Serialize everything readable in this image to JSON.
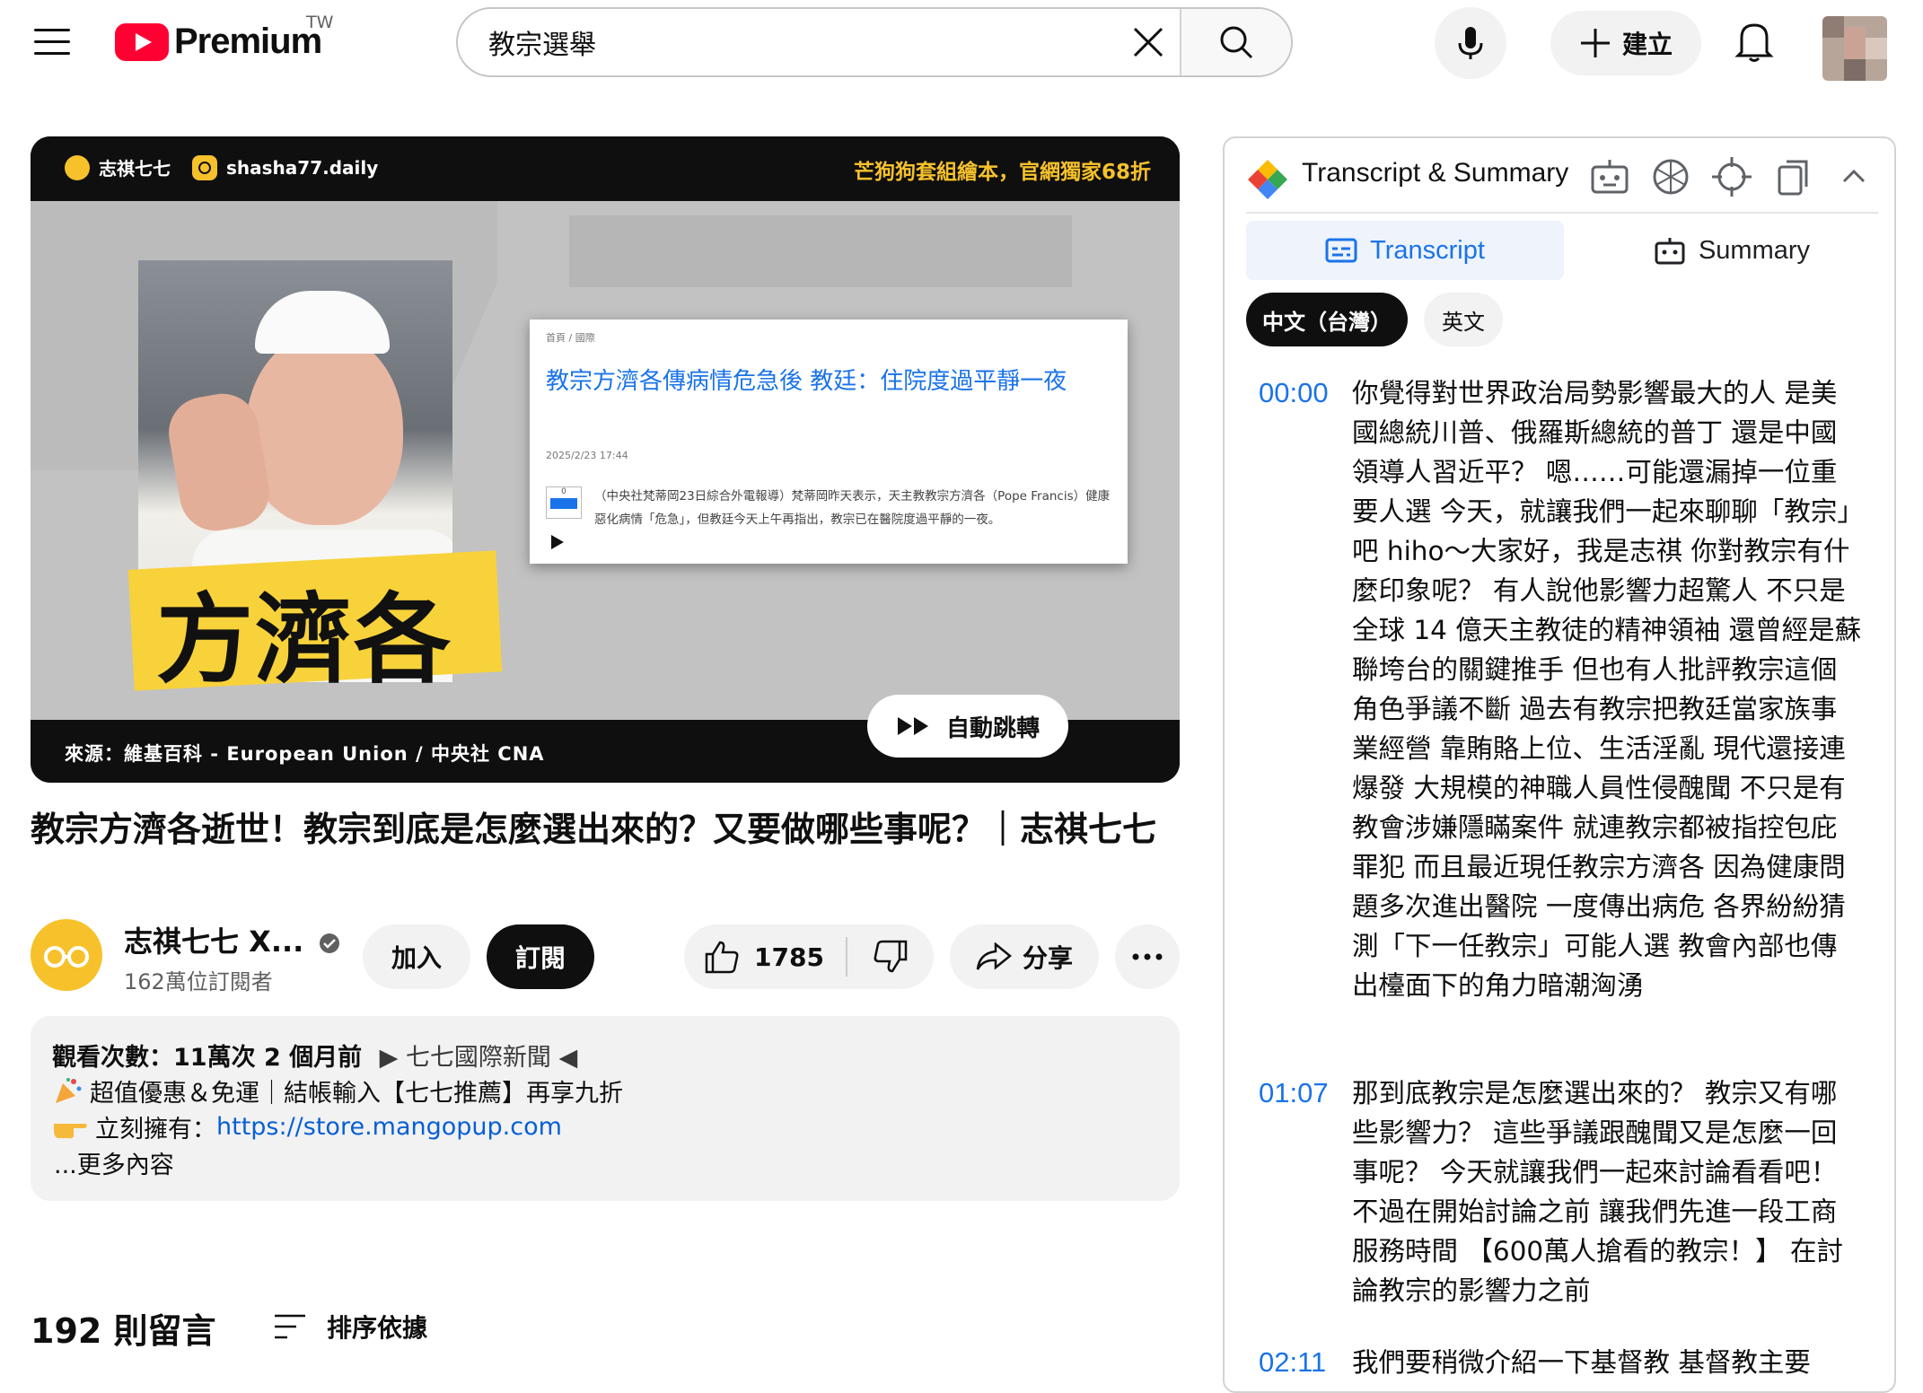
{
  "header": {
    "logo_text": "Premium",
    "region": "TW",
    "search_value": "教宗選舉",
    "create_label": "建立"
  },
  "video": {
    "top_left_handle_1": "志祺七七",
    "top_left_handle_2": "shasha77.daily",
    "top_right_promo": "芒狗狗套組繪本，官網獨家68折",
    "name_overlay": "方濟各",
    "article_breadcrumb": "首頁 / 國際",
    "article_title": "教宗方濟各傳病情危急後 教廷：住院度過平靜一夜",
    "article_date": "2025/2/23 17:44",
    "article_like_count": "0",
    "article_body": "（中央社梵蒂岡23日綜合外電報導）梵蒂岡昨天表示，天主教教宗方濟各（Pope Francis）健康惡化病情「危急」，但教廷今天上午再指出，教宗已在醫院度過平靜的一夜。",
    "source_caption": "來源：維基百科 - European Union / 中央社 CNA",
    "autoskip_label": "自動跳轉",
    "title": "教宗方濟各逝世！教宗到底是怎麼選出來的？又要做哪些事呢？｜志祺七七"
  },
  "channel": {
    "name": "志祺七七 X...",
    "subscribers": "162萬位訂閱者",
    "join_label": "加入",
    "subscribe_label": "訂閱",
    "like_count": "1785",
    "share_label": "分享"
  },
  "description": {
    "stats_line": "觀看次數：11萬次  2 個月前",
    "hashtag_line": "▶ 七七國際新聞 ◀",
    "line2": "超值優惠＆免運｜結帳輸入【七七推薦】再享九折",
    "line3_prefix": "立刻擁有：",
    "line3_link": "https://store.mangopup.com",
    "more_label": "...更多內容"
  },
  "comments": {
    "count_label": "192 則留言",
    "sort_label": "排序依據"
  },
  "panel": {
    "title": "Transcript & Summary",
    "tab_transcript": "Transcript",
    "tab_summary": "Summary",
    "lang_active": "中文（台灣）",
    "lang_other": "英文",
    "segments": [
      {
        "time": "00:00",
        "text": "你覺得對世界政治局勢影響最大的人 是美國總統川普、俄羅斯總統的普丁 還是中國領導人習近平？ 嗯……可能還漏掉一位重要人選 今天，就讓我們一起來聊聊「教宗」吧 hiho～大家好，我是志祺 你對教宗有什麼印象呢？ 有人說他影響力超驚人 不只是全球 14 億天主教徒的精神領袖 還曾經是蘇聯垮台的關鍵推手 但也有人批評教宗這個角色爭議不斷 過去有教宗把教廷當家族事業經營 靠賄賂上位、生活淫亂 現代還接連爆發 大規模的神職人員性侵醜聞 不只是有教會涉嫌隱瞞案件 就連教宗都被指控包庇罪犯 而且最近現任教宗方濟各 因為健康問題多次進出醫院 一度傳出病危 各界紛紛猜測「下一任教宗」可能人選 教會內部也傳出檯面下的角力暗潮洶湧"
      },
      {
        "time": "01:07",
        "text": "那到底教宗是怎麼選出來的？ 教宗又有哪些影響力？ 這些爭議跟醜聞又是怎麼一回事呢？ 今天就讓我們一起來討論看看吧！ 不過在開始討論之前 讓我們先進一段工商服務時間 【600萬人搶看的教宗！】 在討論教宗的影響力之前"
      },
      {
        "time": "02:11",
        "text": "我們要稍微介紹一下基督教 基督教主要"
      }
    ]
  }
}
